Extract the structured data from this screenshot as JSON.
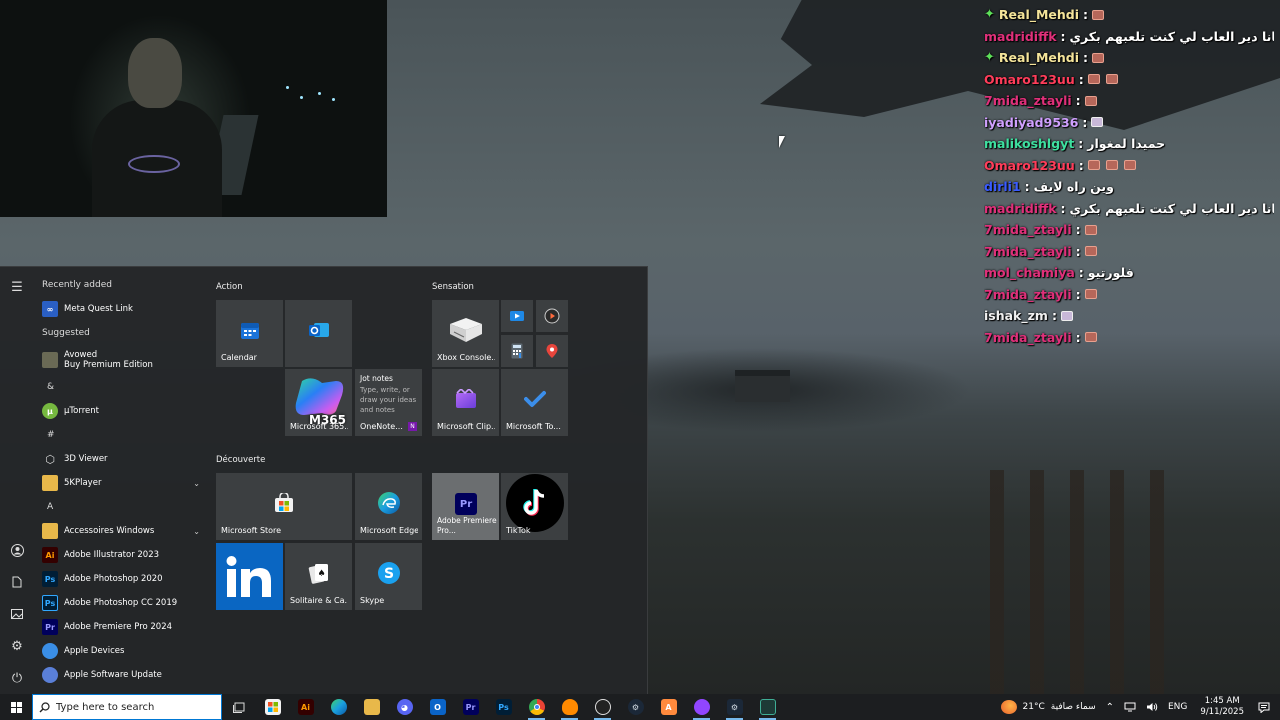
{
  "chat": {
    "messages": [
      {
        "badge": "✦",
        "user": "Real_Mehdi",
        "color": "#f4e49a",
        "text": "",
        "emotes": 1
      },
      {
        "badge": "",
        "user": "madridiffk",
        "color": "#e0307a",
        "text": "لعبة هدي عيانا دير العاب لي كنت تلعبهم بكري",
        "emotes": 0
      },
      {
        "badge": "✦",
        "user": "Real_Mehdi",
        "color": "#f4e49a",
        "text": "",
        "emotes": 1
      },
      {
        "badge": "",
        "user": "Omaro123uu",
        "color": "#ff3d5a",
        "text": "",
        "emotes": 2
      },
      {
        "badge": "",
        "user": "7mida_ztayli",
        "color": "#e0307a",
        "text": "",
        "emotes": 1
      },
      {
        "badge": "",
        "user": "iyadiyad9536",
        "color": "#d0a0ff",
        "text": "",
        "emotes": 1,
        "alt": true
      },
      {
        "badge": "",
        "user": "malikoshlgyt",
        "color": "#3ee0a0",
        "text": "حميدا لمغوار",
        "emotes": 0
      },
      {
        "badge": "",
        "user": "Omaro123uu",
        "color": "#ff3d5a",
        "text": "",
        "emotes": 3
      },
      {
        "badge": "",
        "user": "dirli1",
        "color": "#3a5cff",
        "text": "وين راه لايف",
        "emotes": 0
      },
      {
        "badge": "",
        "user": "madridiffk",
        "color": "#e0307a",
        "text": "لعبة هدي عيانا دير العاب لي كنت تلعبهم بكري",
        "emotes": 0
      },
      {
        "badge": "",
        "user": "7mida_ztayli",
        "color": "#e0307a",
        "text": "",
        "emotes": 1
      },
      {
        "badge": "",
        "user": "7mida_ztayli",
        "color": "#e0307a",
        "text": "",
        "emotes": 1
      },
      {
        "badge": "",
        "user": "mol_chamiya",
        "color": "#e0307a",
        "text": "فلورتيو",
        "emotes": 0
      },
      {
        "badge": "",
        "user": "7mida_ztayli",
        "color": "#e0307a",
        "text": "",
        "emotes": 1
      },
      {
        "badge": "",
        "user": "ishak_zm",
        "color": "#f0f0f0",
        "text": "",
        "emotes": 1,
        "alt": true
      },
      {
        "badge": "",
        "user": "7mida_ztayli",
        "color": "#e0307a",
        "text": "",
        "emotes": 1
      }
    ]
  },
  "start_menu": {
    "recently_added": "Recently added",
    "suggested": "Suggested",
    "apps": {
      "meta": "Meta Quest Link",
      "avowed_1": "Avowed",
      "avowed_2": "Buy Premium Edition",
      "amp": "&",
      "utorrent": "µTorrent",
      "hash": "#",
      "viewer3d": "3D Viewer",
      "player5k": "5KPlayer",
      "letter_a": "A",
      "accessoires": "Accessoires Windows",
      "illustrator": "Adobe Illustrator 2023",
      "ps2020": "Adobe Photoshop 2020",
      "pscc": "Adobe Photoshop CC 2019",
      "premiere": "Adobe Premiere Pro 2024",
      "apple_devices": "Apple Devices",
      "apple_update": "Apple Software Update"
    },
    "groups": {
      "action": "Action",
      "sensation": "Sensation",
      "decouverte": "Découverte"
    },
    "tiles": {
      "calendar": "Calendar",
      "m365": "Microsoft 365...",
      "m365_badge": "M365",
      "jot_title": "Jot notes",
      "jot_body": "Type, write, or draw your ideas and notes",
      "onenote": "OneNote...",
      "xbox": "Xbox Console...",
      "clipchamp": "Microsoft Clip...",
      "todo": "Microsoft To...",
      "store": "Microsoft Store",
      "edge": "Microsoft Edge",
      "premiere_tile": "Adobe Premiere Pro...",
      "tiktok": "TikTok",
      "solitaire": "Solitaire & Ca...",
      "skype": "Skype"
    }
  },
  "taskbar": {
    "search_placeholder": "Type here to search",
    "weather_temp": "21°C",
    "weather_text": "سماء صافية",
    "language": "ENG",
    "time": "1:45 AM",
    "date": "9/11/2025"
  }
}
